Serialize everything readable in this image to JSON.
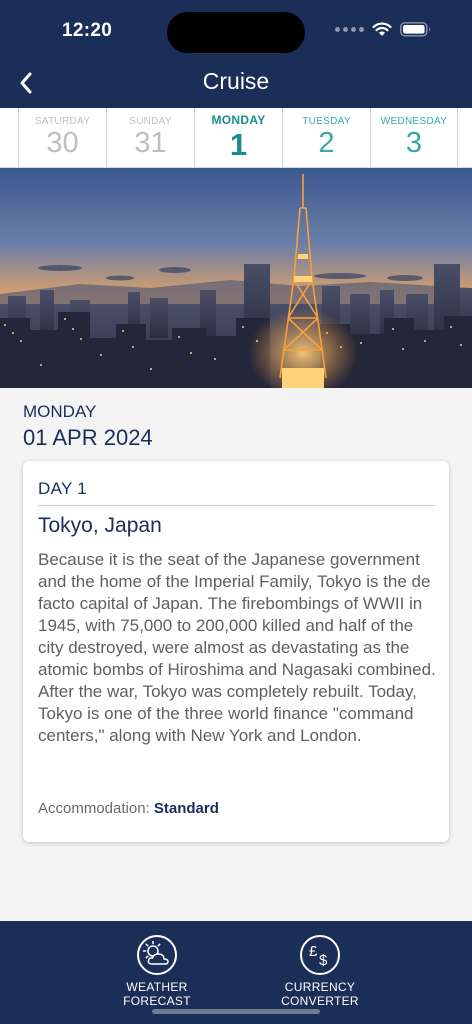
{
  "status_bar": {
    "time": "12:20"
  },
  "header": {
    "title": "Cruise",
    "back_icon": "chevron-left-icon"
  },
  "days": [
    {
      "name": "SATURDAY",
      "number": "30",
      "state": "past"
    },
    {
      "name": "SUNDAY",
      "number": "31",
      "state": "past"
    },
    {
      "name": "MONDAY",
      "number": "1",
      "state": "active"
    },
    {
      "name": "TUESDAY",
      "number": "2",
      "state": "future"
    },
    {
      "name": "WEDNESDAY",
      "number": "3",
      "state": "future"
    }
  ],
  "date": {
    "weekday": "MONDAY",
    "full": "01 APR 2024"
  },
  "card": {
    "day_label": "DAY 1",
    "place": "Tokyo, Japan",
    "description": "Because it is the seat of the Japanese government and the home of the Imperial Family, Tokyo is the de facto capital of Japan. The firebombings of WWII in 1945, with 75,000 to 200,000 killed and half of the city destroyed, were almost as devastating as the atomic bombs of Hiroshima and Nagasaki combined. After the war, Tokyo was completely rebuilt. Today, Tokyo is one of the three world finance \"command centers,\" along with New York and London.",
    "accommodation_label": "Accommodation:",
    "accommodation_value": "Standard"
  },
  "bottom_bar": {
    "weather": {
      "line1": "WEATHER",
      "line2": "FORECAST",
      "icon": "weather-icon"
    },
    "currency": {
      "line1": "CURRENCY",
      "line2": "CONVERTER",
      "icon": "currency-icon"
    }
  },
  "colors": {
    "navy": "#1b2e58",
    "teal_active": "#198e8a",
    "teal_future": "#3aa9a5",
    "past_gray": "#bfbfbf",
    "background": "#f4f4f5"
  }
}
